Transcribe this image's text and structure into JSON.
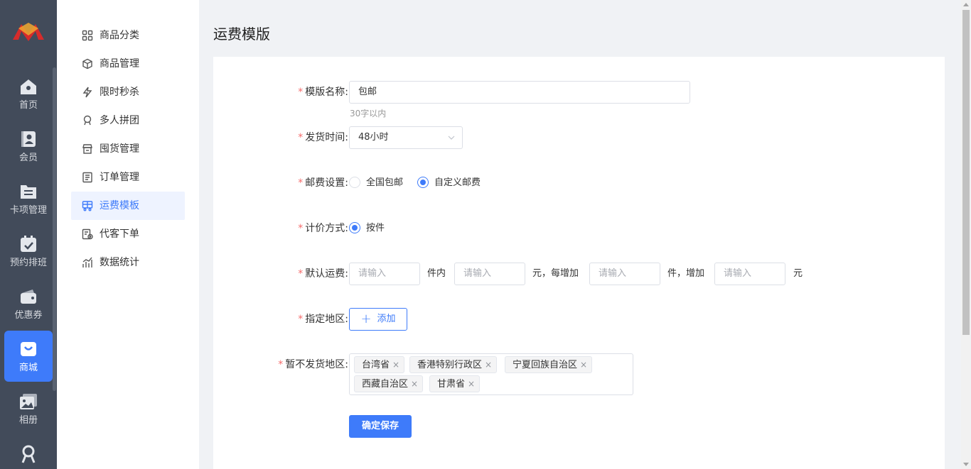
{
  "rail": {
    "items": [
      {
        "label": "首页",
        "icon": "home-icon"
      },
      {
        "label": "会员",
        "icon": "member-icon"
      },
      {
        "label": "卡项管理",
        "icon": "card-folder-icon"
      },
      {
        "label": "预约排班",
        "icon": "calendar-icon"
      },
      {
        "label": "优惠券",
        "icon": "wallet-icon"
      },
      {
        "label": "商城",
        "icon": "shopping-bag-icon"
      },
      {
        "label": "相册",
        "icon": "album-icon"
      },
      {
        "label": "",
        "icon": "user-group-icon"
      }
    ],
    "active_color": "#3e7bfa"
  },
  "submenu": {
    "items": [
      {
        "label": "商品分类",
        "icon": "grid-icon"
      },
      {
        "label": "商品管理",
        "icon": "box-icon"
      },
      {
        "label": "限时秒杀",
        "icon": "flash-icon"
      },
      {
        "label": "多人拼团",
        "icon": "group-icon"
      },
      {
        "label": "囤货管理",
        "icon": "store-icon"
      },
      {
        "label": "订单管理",
        "icon": "order-icon"
      },
      {
        "label": "运费模板",
        "icon": "truck-icon"
      },
      {
        "label": "代客下单",
        "icon": "proxy-order-icon"
      },
      {
        "label": "数据统计",
        "icon": "chart-icon"
      }
    ],
    "active_index": 6
  },
  "page": {
    "title": "运费模版"
  },
  "form": {
    "template_name": {
      "label": "模版名称:",
      "value": "包邮",
      "hint": "30字以内"
    },
    "ship_time": {
      "label": "发货时间:",
      "value": "48小时"
    },
    "postage": {
      "label": "邮费设置:",
      "options": [
        "全国包邮",
        "自定义邮费"
      ],
      "selected": "自定义邮费"
    },
    "pricing": {
      "label": "计价方式:",
      "options": [
        "按件"
      ],
      "selected": "按件"
    },
    "default_fee": {
      "label": "默认运费:",
      "placeholder": "请输入",
      "text1": "件内",
      "text2": "元，每增加",
      "text3": "件，增加",
      "text4": "元"
    },
    "region": {
      "label": "指定地区:",
      "add_label": "添加"
    },
    "no_ship": {
      "label": "暂不发货地区:",
      "tags": [
        "台湾省",
        "香港特别行政区",
        "宁夏回族自治区",
        "西藏自治区",
        "甘肃省"
      ],
      "remove_symbol": "×"
    },
    "required_mark": "*",
    "save_label": "确定保存"
  }
}
